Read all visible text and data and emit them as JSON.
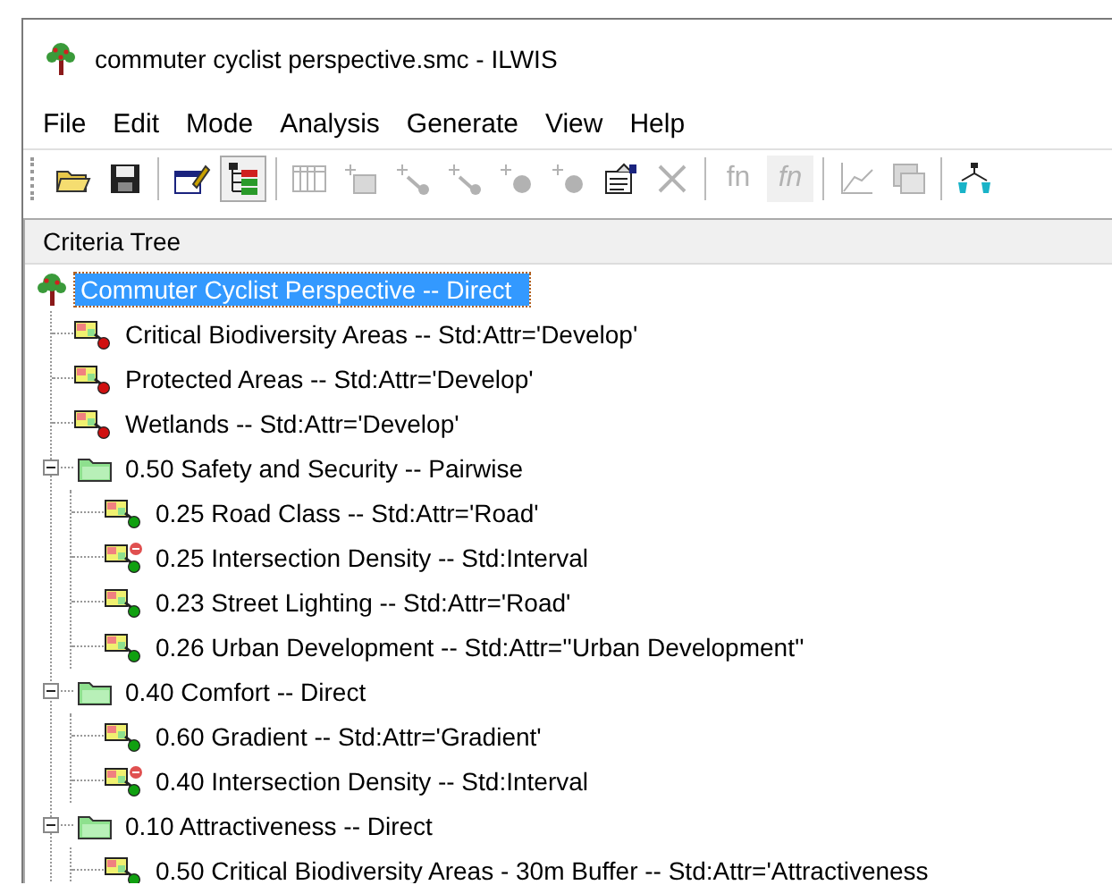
{
  "window": {
    "title": "commuter cyclist perspective.smc - ILWIS"
  },
  "menu": [
    "File",
    "Edit",
    "Mode",
    "Analysis",
    "Generate",
    "View",
    "Help"
  ],
  "toolbar": [
    {
      "kind": "open",
      "disabled": false
    },
    {
      "kind": "save",
      "disabled": false
    },
    {
      "kind": "separator"
    },
    {
      "kind": "edit",
      "disabled": false
    },
    {
      "kind": "tree",
      "disabled": false,
      "selected": true
    },
    {
      "kind": "separator"
    },
    {
      "kind": "table",
      "disabled": true
    },
    {
      "kind": "add-map",
      "disabled": true
    },
    {
      "kind": "add-line",
      "disabled": true
    },
    {
      "kind": "add-line",
      "disabled": true
    },
    {
      "kind": "add-point",
      "disabled": true
    },
    {
      "kind": "add-point",
      "disabled": true
    },
    {
      "kind": "properties",
      "disabled": false
    },
    {
      "kind": "delete",
      "disabled": true
    },
    {
      "kind": "separator"
    },
    {
      "kind": "text",
      "label": "fn",
      "disabled": true
    },
    {
      "kind": "text-struck",
      "label": "fn",
      "disabled": true
    },
    {
      "kind": "separator"
    },
    {
      "kind": "graph",
      "disabled": true
    },
    {
      "kind": "maps",
      "disabled": true
    },
    {
      "kind": "separator"
    },
    {
      "kind": "network",
      "disabled": false
    }
  ],
  "panel": {
    "title": "Criteria Tree"
  },
  "tree": {
    "label": "Commuter Cyclist Perspective -- Direct",
    "kind": "root",
    "selected": true,
    "children": [
      {
        "label": "Critical Biodiversity Areas -- Std:Attr='Develop'",
        "kind": "constraint",
        "cost": false,
        "selected": false
      },
      {
        "label": "Protected Areas -- Std:Attr='Develop'",
        "kind": "constraint",
        "cost": false,
        "selected": false
      },
      {
        "label": "Wetlands -- Std:Attr='Develop'",
        "kind": "constraint",
        "cost": false,
        "selected": false
      },
      {
        "label": "0.50 Safety and Security -- Pairwise",
        "kind": "group",
        "expanded": true,
        "selected": false,
        "children": [
          {
            "label": "0.25 Road Class -- Std:Attr='Road'",
            "kind": "factor",
            "cost": false,
            "selected": false
          },
          {
            "label": "0.25 Intersection Density -- Std:Interval",
            "kind": "factor",
            "cost": true,
            "selected": false
          },
          {
            "label": "0.23 Street Lighting -- Std:Attr='Road'",
            "kind": "factor",
            "cost": false,
            "selected": false
          },
          {
            "label": "0.26 Urban Development -- Std:Attr=''Urban Development''",
            "kind": "factor",
            "cost": false,
            "selected": false
          }
        ]
      },
      {
        "label": "0.40 Comfort -- Direct",
        "kind": "group",
        "expanded": true,
        "selected": false,
        "children": [
          {
            "label": "0.60 Gradient -- Std:Attr='Gradient'",
            "kind": "factor",
            "cost": false,
            "selected": false
          },
          {
            "label": "0.40 Intersection Density -- Std:Interval",
            "kind": "factor",
            "cost": true,
            "selected": false
          }
        ]
      },
      {
        "label": "0.10 Attractiveness -- Direct",
        "kind": "group",
        "expanded": true,
        "selected": false,
        "children": [
          {
            "label": "0.50 Critical Biodiversity Areas - 30m Buffer -- Std:Attr='Attractiveness",
            "kind": "factor",
            "cost": false,
            "selected": false
          }
        ]
      }
    ]
  }
}
